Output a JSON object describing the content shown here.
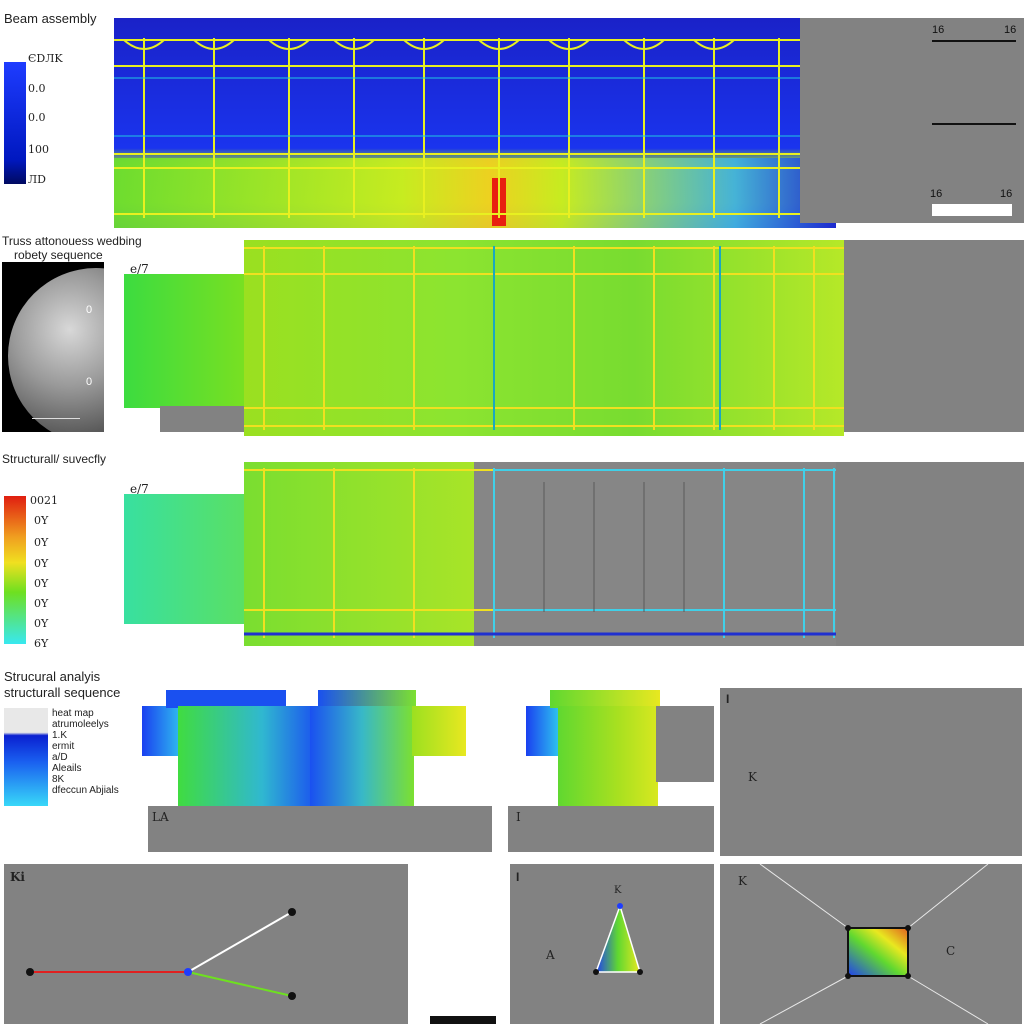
{
  "sections": {
    "beam": {
      "title": "Beam assembly",
      "scale_labels": [
        "ЄDЛK",
        "0.0",
        "0.0",
        "100",
        "ЛD"
      ],
      "dims": [
        "16",
        "16",
        "16",
        "16"
      ]
    },
    "truss": {
      "title_line1": "Truss attonouess wedbing",
      "title_line2": "robety sequence",
      "marker": "e/7",
      "planet_labels": [
        "0",
        "0"
      ]
    },
    "struct": {
      "title": "Structurall/ suvecfly",
      "marker": "e/7",
      "scale_labels": [
        "0021",
        "0Y",
        "0Y",
        "0Y",
        "0Y",
        "0Y",
        "0Y",
        "6Y"
      ]
    },
    "analysis": {
      "title_line1": "Strucural analyis",
      "title_line2": "structurall sequence",
      "legend_lines": [
        "heat map",
        "atrumoleelys",
        "1.K",
        "ermit",
        "a/D",
        "Aleails",
        "8K",
        "dfeccun Abjials"
      ],
      "panel_marks": [
        "LA",
        "I",
        "I",
        "K"
      ]
    },
    "bottom": {
      "panel1_mark": "Ki",
      "panel2_mark": "I",
      "panel2_letters": [
        "A",
        "K"
      ],
      "panel3_letters": [
        "C",
        "K"
      ]
    }
  },
  "colors": {
    "panel_gray": "#828282",
    "blue": "#1e3cff",
    "green": "#6ee020",
    "yellow": "#f0e020",
    "red": "#e01e10",
    "cyan": "#38e8f0"
  }
}
